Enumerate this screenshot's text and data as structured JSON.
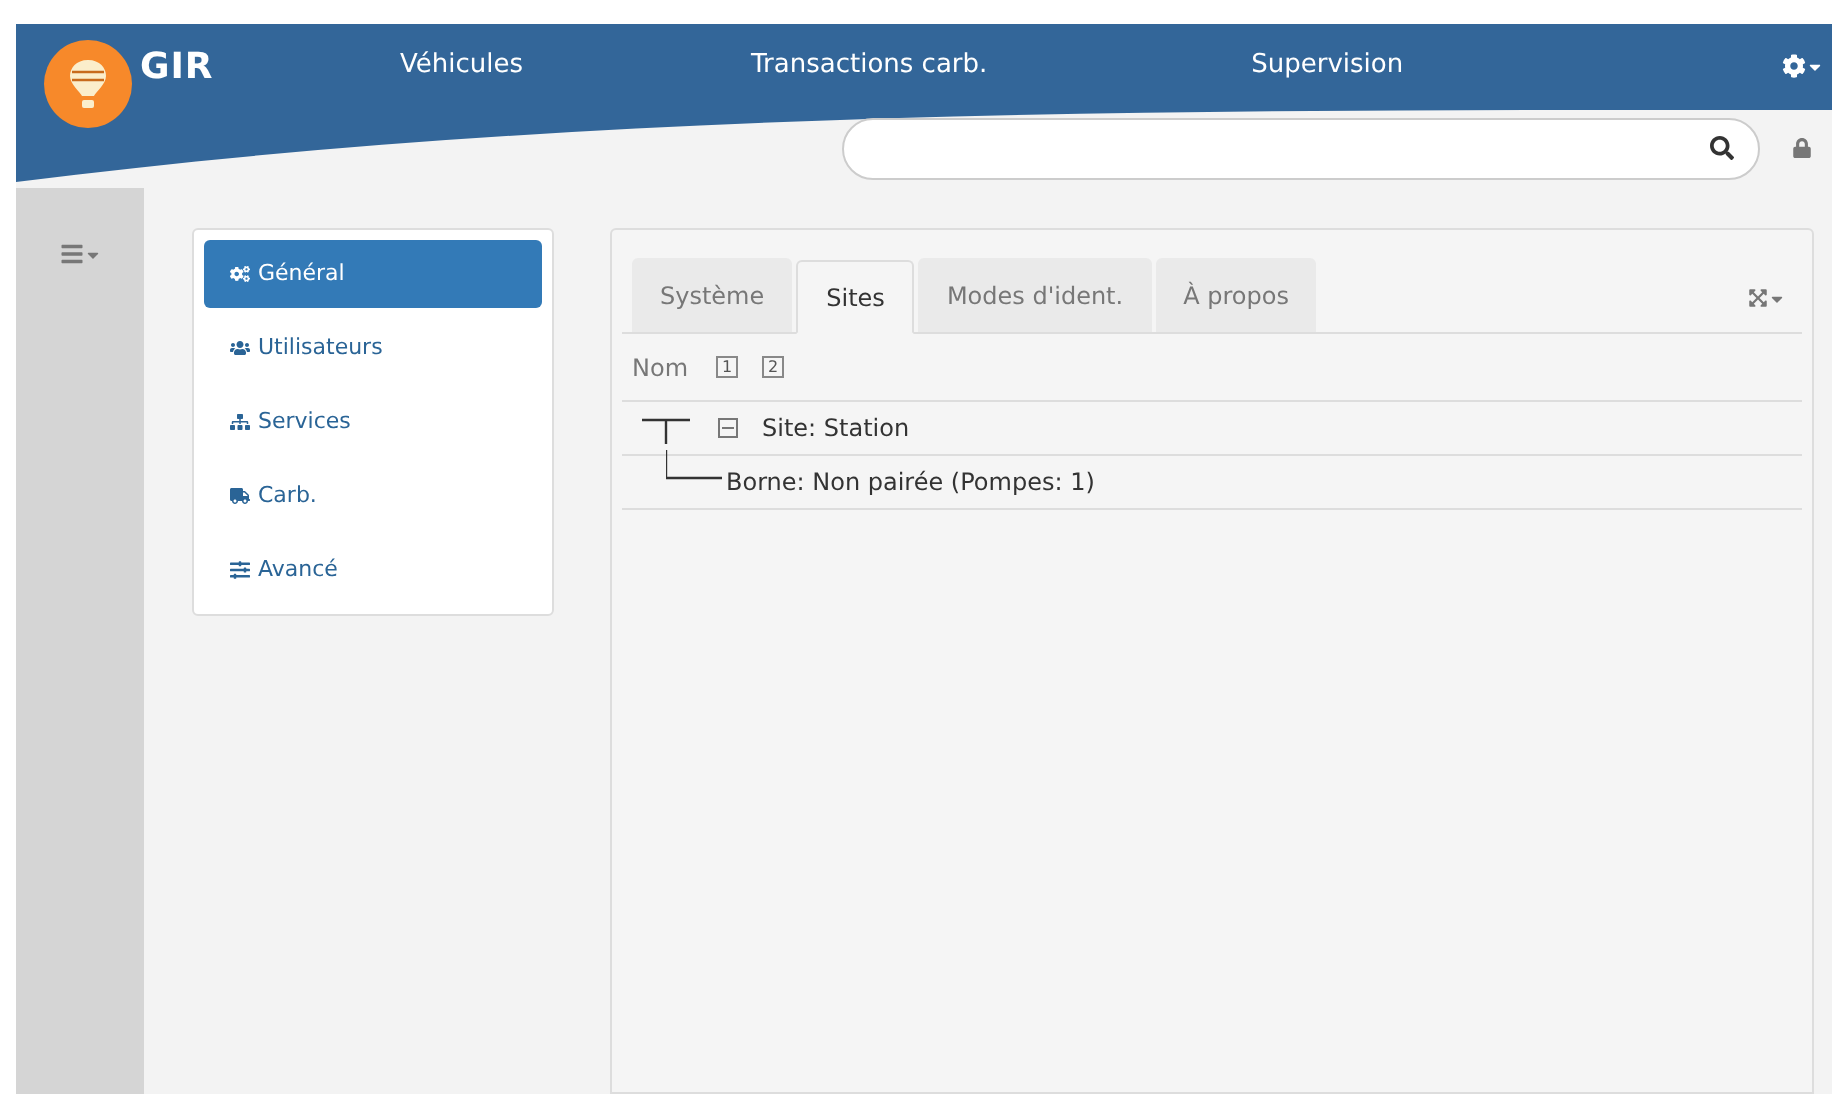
{
  "header": {
    "logo": "GIR",
    "nav": [
      {
        "label": "Véhicules"
      },
      {
        "label": "Transactions carb."
      },
      {
        "label": "Supervision"
      }
    ]
  },
  "menu": [
    {
      "label": "Général",
      "selected": true
    },
    {
      "label": "Utilisateurs",
      "selected": false
    },
    {
      "label": "Services",
      "selected": false
    },
    {
      "label": "Carb.",
      "selected": false
    },
    {
      "label": "Avancé",
      "selected": false
    }
  ],
  "tabs": [
    {
      "label": "Système",
      "selected": false
    },
    {
      "label": "Sites",
      "selected": true
    },
    {
      "label": "Modes d'ident.",
      "selected": false
    },
    {
      "label": "À propos",
      "selected": false
    }
  ],
  "tree": {
    "column": "Nom",
    "levels": [
      "1",
      "2"
    ],
    "nodes": [
      {
        "label": "Site: Station",
        "expanded": true,
        "children": [
          {
            "label": "Borne: Non pairée (Pompes: 1)"
          }
        ]
      }
    ]
  }
}
